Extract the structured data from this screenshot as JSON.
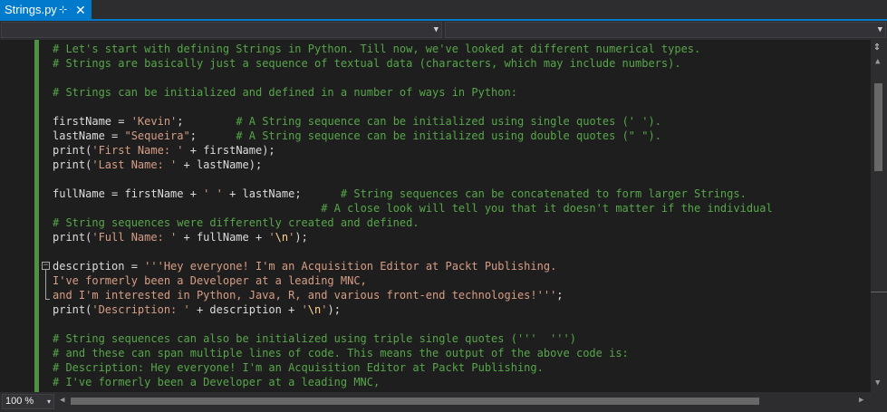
{
  "tab": {
    "title": "Strings.py",
    "pin_glyph": "⊹",
    "close_glyph": "✕"
  },
  "navigation": {
    "left_combo_value": "",
    "right_combo_value": ""
  },
  "code_lines": [
    {
      "tokens": [
        {
          "t": "c",
          "v": "# Let's start with defining Strings in Python. Till now, we've looked at different numerical types."
        }
      ]
    },
    {
      "tokens": [
        {
          "t": "c",
          "v": "# Strings are basically just a sequence of textual data (characters, which may include numbers)."
        }
      ]
    },
    {
      "tokens": []
    },
    {
      "tokens": [
        {
          "t": "c",
          "v": "# Strings can be initialized and defined in a number of ways in Python:"
        }
      ]
    },
    {
      "tokens": []
    },
    {
      "tokens": [
        {
          "t": "p",
          "v": "firstName = "
        },
        {
          "t": "s",
          "v": "'Kevin'"
        },
        {
          "t": "p",
          "v": ";        "
        },
        {
          "t": "c",
          "v": "# A String sequence can be initialized using single quotes (' ')."
        }
      ]
    },
    {
      "tokens": [
        {
          "t": "p",
          "v": "lastName = "
        },
        {
          "t": "s",
          "v": "\"Sequeira\""
        },
        {
          "t": "p",
          "v": ";      "
        },
        {
          "t": "c",
          "v": "# A String sequence can be initialized using double quotes (\" \")."
        }
      ]
    },
    {
      "tokens": [
        {
          "t": "p",
          "v": "print("
        },
        {
          "t": "s",
          "v": "'First Name: '"
        },
        {
          "t": "p",
          "v": " + firstName);"
        }
      ]
    },
    {
      "tokens": [
        {
          "t": "p",
          "v": "print("
        },
        {
          "t": "s",
          "v": "'Last Name: '"
        },
        {
          "t": "p",
          "v": " + lastName);"
        }
      ]
    },
    {
      "tokens": []
    },
    {
      "tokens": [
        {
          "t": "p",
          "v": "fullName = firstName + "
        },
        {
          "t": "s",
          "v": "' '"
        },
        {
          "t": "p",
          "v": " + lastName;      "
        },
        {
          "t": "c",
          "v": "# String sequences can be concatenated to form larger Strings."
        }
      ]
    },
    {
      "tokens": [
        {
          "t": "p",
          "v": "                                         "
        },
        {
          "t": "c",
          "v": "# A close look will tell you that it doesn't matter if the individual"
        }
      ]
    },
    {
      "tokens": [
        {
          "t": "c",
          "v": "# String sequences were differently created and defined."
        }
      ]
    },
    {
      "tokens": [
        {
          "t": "p",
          "v": "print("
        },
        {
          "t": "s",
          "v": "'Full Name: '"
        },
        {
          "t": "p",
          "v": " + fullName + "
        },
        {
          "t": "s",
          "v": "'"
        },
        {
          "t": "e",
          "v": "\\n"
        },
        {
          "t": "s",
          "v": "'"
        },
        {
          "t": "p",
          "v": ");"
        }
      ]
    },
    {
      "tokens": []
    },
    {
      "tokens": [
        {
          "t": "p",
          "v": "description = "
        },
        {
          "t": "s",
          "v": "'''Hey everyone! I'm an Acquisition Editor at Packt Publishing."
        }
      ]
    },
    {
      "tokens": [
        {
          "t": "s",
          "v": "I've formerly been a Developer at a leading MNC,"
        }
      ]
    },
    {
      "tokens": [
        {
          "t": "s",
          "v": "and I'm interested in Python, Java, R, and various front-end technologies!'''"
        },
        {
          "t": "p",
          "v": ";"
        }
      ]
    },
    {
      "tokens": [
        {
          "t": "p",
          "v": "print("
        },
        {
          "t": "s",
          "v": "'Description: '"
        },
        {
          "t": "p",
          "v": " + description + "
        },
        {
          "t": "s",
          "v": "'"
        },
        {
          "t": "e",
          "v": "\\n"
        },
        {
          "t": "s",
          "v": "'"
        },
        {
          "t": "p",
          "v": ");"
        }
      ]
    },
    {
      "tokens": []
    },
    {
      "tokens": [
        {
          "t": "c",
          "v": "# String sequences can also be initialized using triple single quotes ('''  ''')"
        }
      ]
    },
    {
      "tokens": [
        {
          "t": "c",
          "v": "# and these can span multiple lines of code. This means the output of the above code is:"
        }
      ]
    },
    {
      "tokens": [
        {
          "t": "c",
          "v": "# Description: Hey everyone! I'm an Acquisition Editor at Packt Publishing."
        }
      ]
    },
    {
      "tokens": [
        {
          "t": "c",
          "v": "# I've formerly been a Developer at a leading MNC,"
        }
      ]
    }
  ],
  "fold_glyph": "−",
  "status": {
    "zoom": "100 %",
    "zoom_arrow": "▾"
  },
  "scroll": {
    "split_glyph": "⇕",
    "up": "▲",
    "down": "▼",
    "left": "◀",
    "right": "▶"
  },
  "colors": {
    "comment": "#57a64a",
    "string": "#d69d85",
    "plain": "#dcdcdc",
    "accent": "#007acc"
  }
}
